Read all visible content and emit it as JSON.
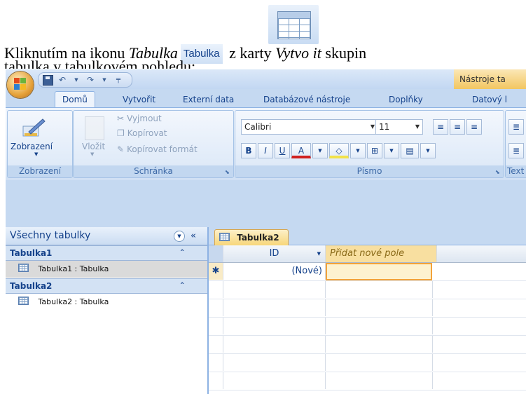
{
  "document": {
    "icon_label": "Tabulka",
    "line1_a": "Kliknutím na ikonu ",
    "line1_b": "Tabulka",
    "line1_c": " z karty ",
    "line1_d": "Vytvo it",
    "line1_e": " skupin",
    "line2": "tabulka v tabulkovém pohledu:"
  },
  "window": {
    "context_title": "Nástroje ta",
    "tabs": [
      "Domů",
      "Vytvořit",
      "Externí data",
      "Databázové nástroje",
      "Doplňky",
      "Datový l"
    ]
  },
  "ribbon": {
    "view": {
      "button": "Zobrazení",
      "group": "Zobrazení"
    },
    "clipboard": {
      "paste": "Vložit",
      "cut": "Vyjmout",
      "copy": "Kopírovat",
      "format_painter": "Kopírovat formát",
      "group": "Schránka"
    },
    "font": {
      "name": "Calibri",
      "size": "11",
      "bold": "B",
      "italic": "I",
      "underline": "U",
      "color": "A",
      "group": "Písmo"
    },
    "text_group_partial": "Text"
  },
  "nav_pane": {
    "header": "Všechny tabulky",
    "groups": [
      {
        "title": "Tabulka1",
        "items": [
          "Tabulka1 : Tabulka"
        ]
      },
      {
        "title": "Tabulka2",
        "items": [
          "Tabulka2 : Tabulka"
        ]
      }
    ]
  },
  "datasheet": {
    "tab": "Tabulka2",
    "columns": [
      "ID",
      "Přidat nové pole"
    ],
    "new_row_marker": "✱",
    "new_row_value": "(Nové)"
  },
  "colors": {
    "accent": "#15428b",
    "ribbon_bg": "#dce8f7",
    "active_tab": "#f7d67a",
    "selected_cell": "#fdf2d0"
  }
}
